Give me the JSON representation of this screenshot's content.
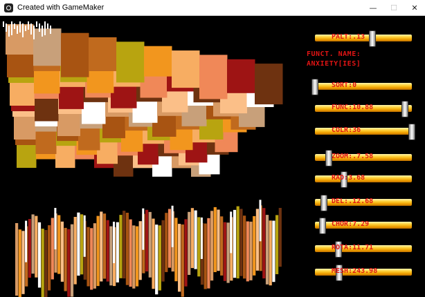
{
  "window": {
    "title": "Created with GameMaker",
    "minimize_glyph": "—",
    "maximize_glyph": "☐",
    "close_glyph": "✕"
  },
  "panel": {
    "funct_title": "FUNCT. NAME:",
    "funct_value": "ANXIETY[IES]"
  },
  "sliders": [
    {
      "id": "palette",
      "label": "PALT:.13",
      "value": 0.59
    },
    {
      "id": "sort",
      "label": "SORT:0",
      "value": 0.0
    },
    {
      "id": "func",
      "label": "FUNC:10.88",
      "value": 0.93
    },
    {
      "id": "colr",
      "label": "COLR:36",
      "value": 1.0
    },
    {
      "id": "zoom",
      "label": "ZOOM:.7.58",
      "value": 0.14
    },
    {
      "id": "rad",
      "label": "RAD:3.68",
      "value": 0.3
    },
    {
      "id": "del",
      "label": "DEL:.12.68",
      "value": 0.09
    },
    {
      "id": "chor",
      "label": "CHOR:7.29",
      "value": 0.08
    },
    {
      "id": "rota",
      "label": "ROTA:11.71",
      "value": 0.24
    },
    {
      "id": "mesh",
      "label": "MESH:243.98",
      "value": 0.25
    }
  ],
  "colors": {
    "background": "#000000",
    "label": "#e11414",
    "palette": [
      "#d89a64",
      "#c8a07a",
      "#a85412",
      "#c06a1e",
      "#b8a410",
      "#f2961e",
      "#f7ad62",
      "#f08858",
      "#9e1414",
      "#6e3210",
      "#fbbf88",
      "#ffffff"
    ]
  }
}
